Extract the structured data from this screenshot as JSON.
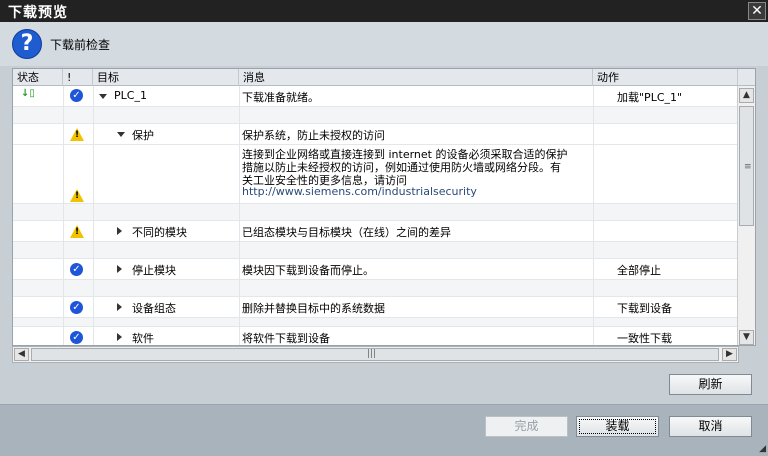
{
  "window": {
    "title": "下载预览",
    "close_label": "✕"
  },
  "header": {
    "title": "下载前检查",
    "icon": "question-icon"
  },
  "columns": {
    "status": "状态",
    "bang": "!",
    "target": "目标",
    "message": "消息",
    "action": "动作"
  },
  "rows": [
    {
      "target": "PLC_1",
      "message": "下载准备就绪。",
      "action": "加载\"PLC_1\""
    },
    {
      "target": "保护",
      "message": "保护系统，防止未授权的访问"
    },
    {
      "message_lines": [
        "连接到企业网络或直接连接到 internet 的设备必须采取合适的保护",
        "措施以防止未经授权的访问，例如通过使用防火墙或网络分段。有",
        "关工业安全性的更多信息，请访问"
      ],
      "link": "http://www.siemens.com/industrialsecurity"
    },
    {
      "target": "不同的模块",
      "message": "已组态模块与目标模块（在线）之间的差异"
    },
    {
      "target": "停止模块",
      "message": "模块因下载到设备而停止。",
      "action": "全部停止"
    },
    {
      "target": "设备组态",
      "message": "删除并替换目标中的系统数据",
      "action": "下载到设备"
    },
    {
      "target": "软件",
      "message": "将软件下载到设备",
      "action": "一致性下载"
    }
  ],
  "buttons": {
    "refresh": "刷新",
    "finish": "完成",
    "load": "装载",
    "cancel": "取消"
  },
  "colors": {
    "titlebar": "#222222",
    "header_bg": "#d3dae0",
    "footer_bg": "#a9b3bc",
    "warn": "#f2c200",
    "ok": "#1f55d8"
  }
}
